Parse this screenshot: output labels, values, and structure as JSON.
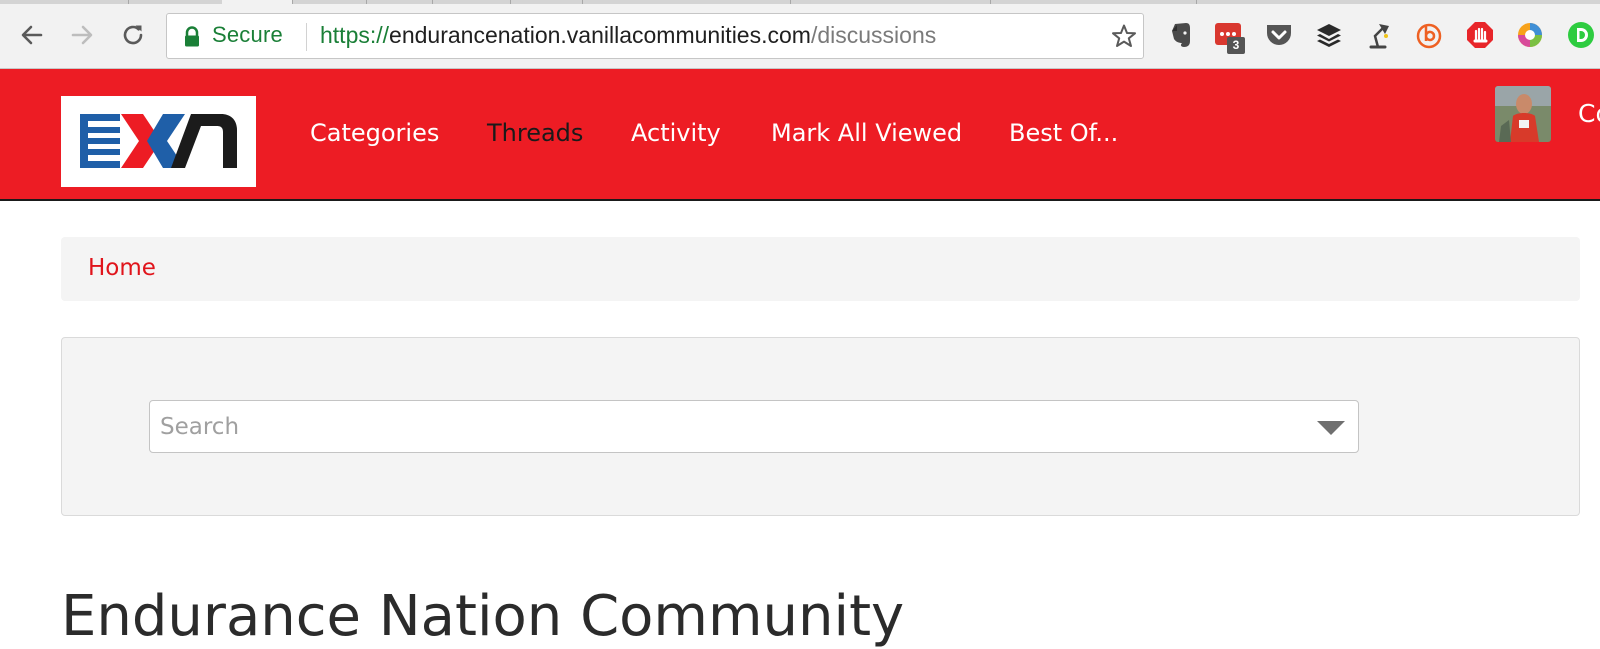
{
  "browser": {
    "secure_label": "Secure",
    "url": {
      "scheme": "https://",
      "host": "endurancenation.vanillacommunities.com",
      "path": "/discussions"
    },
    "extensions": [
      {
        "name": "evernote-icon"
      },
      {
        "name": "extension-badge-icon",
        "badge": "3"
      },
      {
        "name": "pocket-icon"
      },
      {
        "name": "buffer-icon"
      },
      {
        "name": "desk-lamp-icon"
      },
      {
        "name": "bitly-icon"
      },
      {
        "name": "adblock-icon"
      },
      {
        "name": "color-wheel-icon"
      },
      {
        "name": "green-d-icon"
      }
    ]
  },
  "site": {
    "logo_text": "EXN",
    "nav": [
      {
        "label": "Categories",
        "active": false
      },
      {
        "label": "Threads",
        "active": true
      },
      {
        "label": "Activity",
        "active": false
      },
      {
        "label": "Mark All Viewed",
        "active": false
      },
      {
        "label": "Best Of...",
        "active": false
      }
    ],
    "user_partial": "Co"
  },
  "breadcrumb": {
    "home": "Home"
  },
  "search": {
    "placeholder": "Search"
  },
  "page": {
    "title": "Endurance Nation Community"
  },
  "colors": {
    "brand_red": "#ed1c24",
    "link_red": "#e0141b",
    "secure_green": "#1a7f37",
    "logo_blue": "#1f5fa8"
  }
}
